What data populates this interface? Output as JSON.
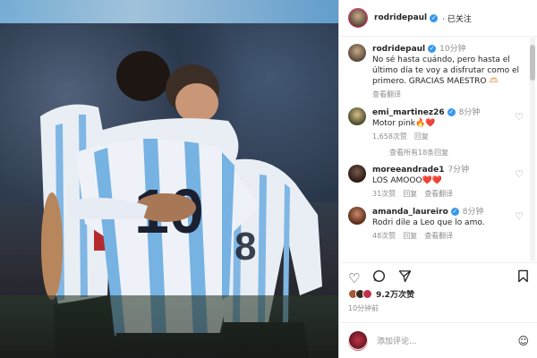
{
  "post": {
    "username": "rodridepaul",
    "follow_label": "· 已关注",
    "caption": {
      "username": "rodridepaul",
      "time": "10分钟",
      "text": "No sé hasta cuándo, pero hasta el último día te voy a disfrutar como el primero. GRACIAS MAESTRO 🫶🏻",
      "translate": "查看翻译"
    },
    "comments": [
      {
        "username": "emi_martinez26",
        "time": "8分钟",
        "text": "Motor pink🔥❤️",
        "likes": "1,658次赞",
        "reply": "回复",
        "translate": ""
      },
      {
        "username": "moreeandrade1",
        "time": "7分钟",
        "text": "LOS AMOOO❤️❤️",
        "likes": "31次赞",
        "reply": "回复",
        "translate": "查看翻译"
      },
      {
        "username": "amanda_laureiro",
        "time": "8分钟",
        "text": "Rodri dile a Leo que lo amo.",
        "likes": "48次赞",
        "reply": "回复",
        "translate": "查看翻译"
      }
    ],
    "view_replies": "查看所有18条回复",
    "likes_count": "9.2万次赞",
    "post_time": "10分钟前",
    "add_comment_placeholder": "添加评论...",
    "icons": [
      "heart-icon",
      "comment-icon",
      "share-icon",
      "bookmark-icon",
      "emoji-icon",
      "verified-icon"
    ],
    "accent_color": "#3897f0",
    "like_color": "#ed4956"
  }
}
